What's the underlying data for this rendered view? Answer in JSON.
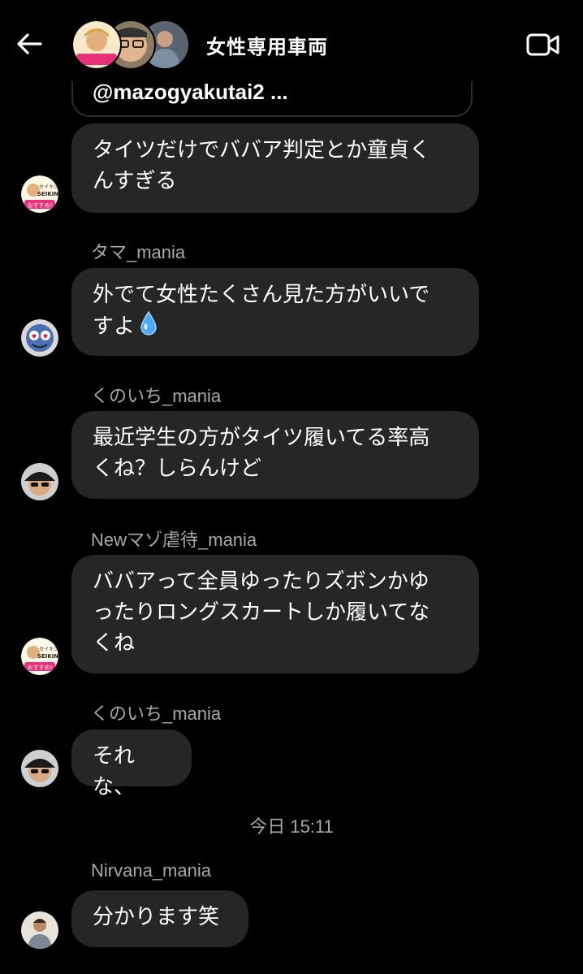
{
  "header": {
    "title": "女性専用車両",
    "back_icon": "arrow-left-icon",
    "video_icon": "video-camera-icon"
  },
  "quoted": {
    "text": "@mazogyakutai2 ..."
  },
  "messages": [
    {
      "sender": "",
      "lines": [
        "タイツだけでババア判定とか童貞く",
        "んすぎる"
      ],
      "avatar": "seikin-badge"
    },
    {
      "sender": "タマ_mania",
      "lines": [
        "外でて女性たくさん見た方がいいで",
        "すよ"
      ],
      "emoji": "droplet-icon",
      "avatar": "mascot"
    },
    {
      "sender": "くのいち_mania",
      "lines": [
        "最近学生の方がタイツ履いてる率高",
        "くね？しらんけど"
      ],
      "avatar": "cap-man"
    },
    {
      "sender": "Newマゾ虐待_mania",
      "lines": [
        "ババアって全員ゆったりズボンかゆ",
        "ったりロングスカートしか履いてな",
        "くね"
      ],
      "avatar": "seikin-badge"
    },
    {
      "sender": "くのいち_mania",
      "lines": [
        "それな、"
      ],
      "avatar": "cap-man"
    },
    {
      "sender": "Nirvana_mania",
      "lines": [
        "分かります笑"
      ],
      "avatar": "person"
    }
  ],
  "timestamp": "今日 15:11",
  "badge_text": {
    "top": "セイキン",
    "main": "SEIKIN",
    "bottom": "おすすめ!"
  },
  "colors": {
    "background": "#000000",
    "bubble": "#262626",
    "sender": "#a8a8a8",
    "badge_pink": "#e8317a",
    "droplet": "#4aa8ff"
  }
}
